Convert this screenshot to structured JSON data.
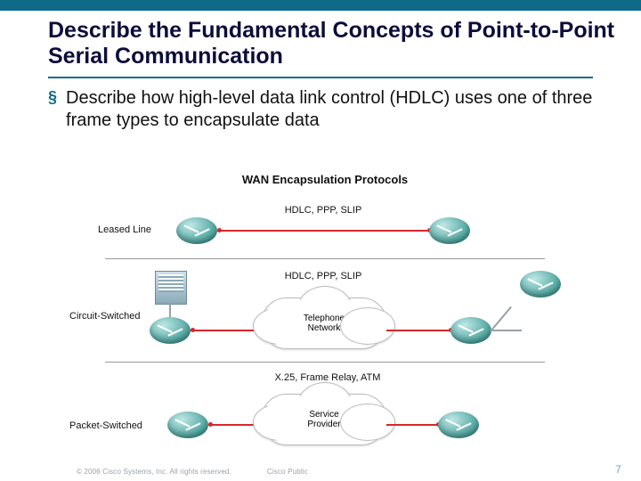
{
  "topbar_color": "#0f6a8a",
  "title": "Describe the Fundamental Concepts of Point-to-Point Serial Communication",
  "bullet": "Describe how high-level data link control (HDLC) uses one of three frame types to encapsulate data",
  "diagram": {
    "title": "WAN Encapsulation Protocols",
    "rows": {
      "leased": {
        "label": "Leased Line",
        "proto": "HDLC, PPP, SLIP"
      },
      "circuit": {
        "label": "Circuit-Switched",
        "proto": "HDLC, PPP, SLIP",
        "cloud": "Telephone\nNetwork"
      },
      "packet": {
        "label": "Packet-Switched",
        "proto": "X.25, Frame Relay, ATM",
        "cloud": "Service\nProvider"
      }
    }
  },
  "footer": {
    "copyright": "© 2006 Cisco Systems, Inc. All rights reserved.",
    "classification": "Cisco Public",
    "page": "7"
  }
}
